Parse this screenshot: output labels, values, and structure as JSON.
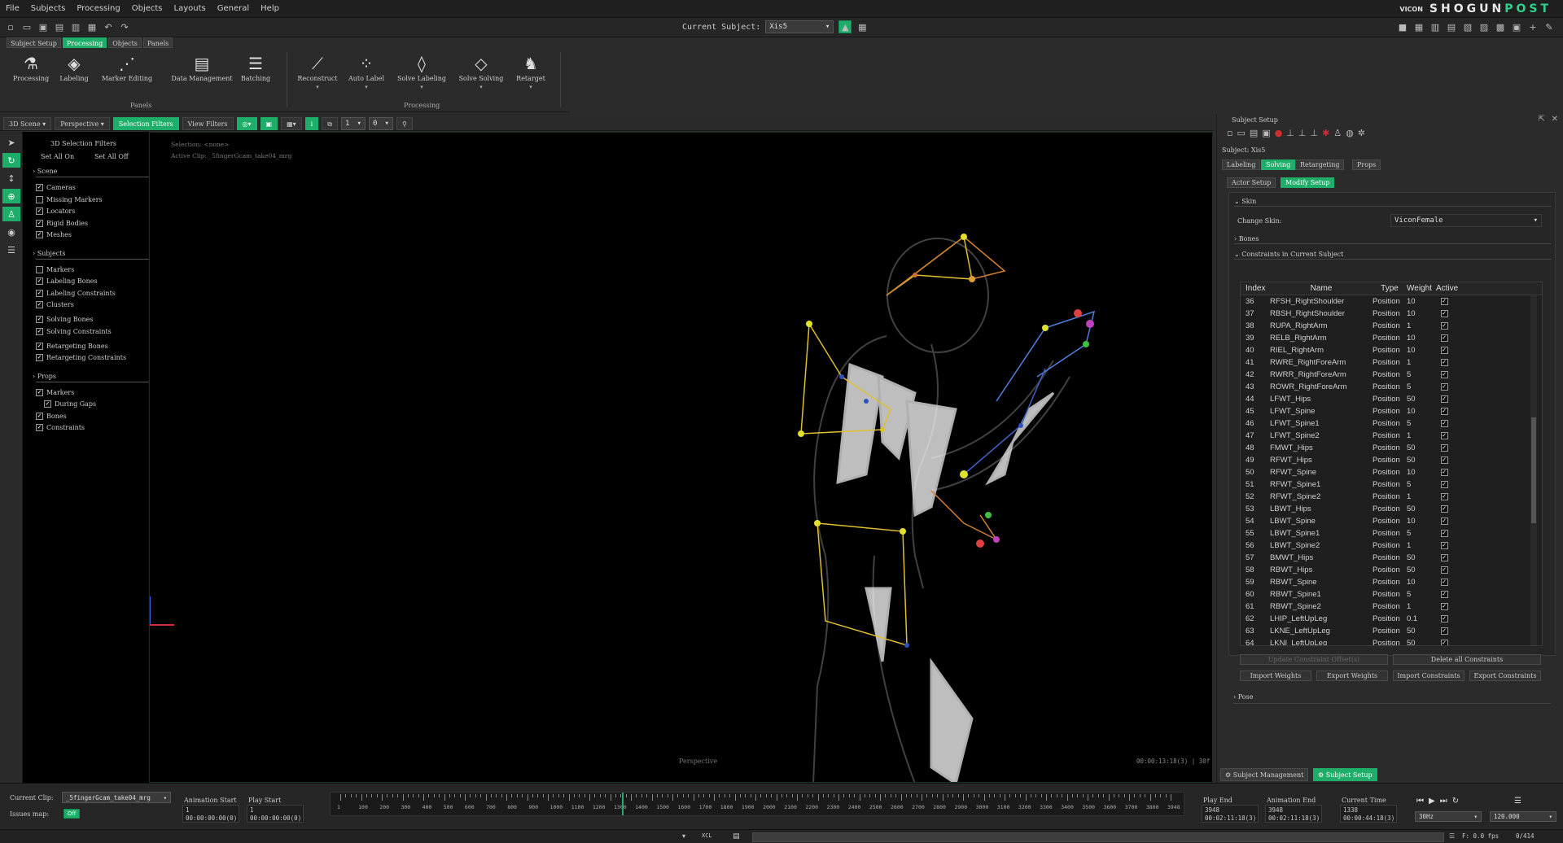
{
  "menu": [
    "File",
    "Subjects",
    "Processing",
    "Objects",
    "Layouts",
    "General",
    "Help"
  ],
  "brand": {
    "vicon": "VICON",
    "shogun": "SHOGUN",
    "post": "POST"
  },
  "current_subject": {
    "label": "Current Subject:",
    "value": "Xis5"
  },
  "mode_tabs": [
    "Subject Setup",
    "Processing",
    "Objects",
    "Panels"
  ],
  "ribbon": {
    "buttons": [
      "Processing",
      "Labeling",
      "Marker Editing",
      "Data Management",
      "Batching",
      "Reconstruct",
      "Auto Label",
      "Solve Labeling",
      "Solve Solving",
      "Retarget"
    ],
    "groups": [
      "Panels",
      "Processing"
    ]
  },
  "viewport_bar": {
    "scene": "3D Scene",
    "view": "Perspective",
    "selection_filters": "Selection Filters",
    "view_filters": "View Filters",
    "field1": "1",
    "field2": "0"
  },
  "filters": {
    "title": "3D Selection Filters",
    "set_all_on": "Set All On",
    "set_all_off": "Set All Off",
    "sections": [
      {
        "name": "Scene",
        "items": [
          {
            "label": "Cameras",
            "checked": true
          },
          {
            "label": "Missing Markers",
            "checked": false
          },
          {
            "label": "Locators",
            "checked": true
          },
          {
            "label": "Rigid Bodies",
            "checked": true
          },
          {
            "label": "Meshes",
            "checked": true
          }
        ]
      },
      {
        "name": "Subjects",
        "items": [
          {
            "label": "Markers",
            "checked": false
          },
          {
            "label": "Labeling Bones",
            "checked": true
          },
          {
            "label": "Labeling Constraints",
            "checked": true
          },
          {
            "label": "Clusters",
            "checked": true
          },
          {
            "label": "Solving Bones",
            "checked": true
          },
          {
            "label": "Solving Constraints",
            "checked": true
          },
          {
            "label": "Retargeting Bones",
            "checked": true
          },
          {
            "label": "Retargeting Constraints",
            "checked": true
          }
        ]
      },
      {
        "name": "Props",
        "items": [
          {
            "label": "Markers",
            "checked": true
          },
          {
            "label": "During Gaps",
            "checked": true
          },
          {
            "label": "Bones",
            "checked": true
          },
          {
            "label": "Constraints",
            "checked": true
          }
        ]
      }
    ]
  },
  "viewport": {
    "selection": "Selection: <none>",
    "active_clip": "Active Clip: _5fingerGcam_take04_mrg",
    "camera_label": "Perspective",
    "timecode": "00:00:13:18(3) | 30f"
  },
  "subject_setup": {
    "panel_title": "Subject Setup",
    "subject": "Subject: Xis5",
    "tabs": [
      "Labeling",
      "Solving",
      "Retargeting",
      "Props"
    ],
    "subtabs": [
      "Actor Setup",
      "Modify Setup"
    ],
    "skin_section": "Skin",
    "change_skin_label": "Change Skin:",
    "change_skin_value": "ViconFemale",
    "bones_section": "Bones",
    "constraints_section": "Constraints in Current Subject",
    "columns": [
      "Index",
      "Name",
      "Type",
      "Weight",
      "Active"
    ],
    "rows": [
      [
        "36",
        "RFSH_RightShoulder",
        "Position",
        "10"
      ],
      [
        "37",
        "RBSH_RightShoulder",
        "Position",
        "10"
      ],
      [
        "38",
        "RUPA_RightArm",
        "Position",
        "1"
      ],
      [
        "39",
        "RELB_RightArm",
        "Position",
        "10"
      ],
      [
        "40",
        "RIEL_RightArm",
        "Position",
        "10"
      ],
      [
        "41",
        "RWRE_RightForeArm",
        "Position",
        "1"
      ],
      [
        "42",
        "RWRR_RightForeArm",
        "Position",
        "5"
      ],
      [
        "43",
        "ROWR_RightForeArm",
        "Position",
        "5"
      ],
      [
        "44",
        "LFWT_Hips",
        "Position",
        "50"
      ],
      [
        "45",
        "LFWT_Spine",
        "Position",
        "10"
      ],
      [
        "46",
        "LFWT_Spine1",
        "Position",
        "5"
      ],
      [
        "47",
        "LFWT_Spine2",
        "Position",
        "1"
      ],
      [
        "48",
        "FMWT_Hips",
        "Position",
        "50"
      ],
      [
        "49",
        "RFWT_Hips",
        "Position",
        "50"
      ],
      [
        "50",
        "RFWT_Spine",
        "Position",
        "10"
      ],
      [
        "51",
        "RFWT_Spine1",
        "Position",
        "5"
      ],
      [
        "52",
        "RFWT_Spine2",
        "Position",
        "1"
      ],
      [
        "53",
        "LBWT_Hips",
        "Position",
        "50"
      ],
      [
        "54",
        "LBWT_Spine",
        "Position",
        "10"
      ],
      [
        "55",
        "LBWT_Spine1",
        "Position",
        "5"
      ],
      [
        "56",
        "LBWT_Spine2",
        "Position",
        "1"
      ],
      [
        "57",
        "BMWT_Hips",
        "Position",
        "50"
      ],
      [
        "58",
        "RBWT_Hips",
        "Position",
        "50"
      ],
      [
        "59",
        "RBWT_Spine",
        "Position",
        "10"
      ],
      [
        "60",
        "RBWT_Spine1",
        "Position",
        "5"
      ],
      [
        "61",
        "RBWT_Spine2",
        "Position",
        "1"
      ],
      [
        "62",
        "LHIP_LeftUpLeg",
        "Position",
        "0.1"
      ],
      [
        "63",
        "LKNE_LeftUpLeg",
        "Position",
        "50"
      ],
      [
        "64",
        "LKNI_LeftUpLeg",
        "Position",
        "50"
      ]
    ],
    "update_offset": "Update Constraint Offset(s)",
    "delete_all": "Delete all Constraints",
    "import_weights": "Import Weights",
    "export_weights": "Export Weights",
    "import_constraints": "Import Constraints",
    "export_constraints": "Export Constraints",
    "pose_section": "Pose",
    "bottom_tabs": [
      "Subject Management",
      "Subject Setup"
    ]
  },
  "bottom": {
    "current_clip_label": "Current Clip:",
    "current_clip": "_5fingerGcam_take04_mrg",
    "issues_label": "Issues map:",
    "issues_toggle": "Off",
    "animation_start_label": "Animation Start",
    "animation_start": "1",
    "animation_start_tc": "00:00:00:00(0)",
    "play_start_label": "Play Start",
    "play_start": "1",
    "play_start_tc": "00:00:00:00(0)",
    "play_end_label": "Play End",
    "play_end": "3948",
    "play_end_tc": "00:02:11:18(3)",
    "animation_end_label": "Animation End",
    "animation_end": "3948",
    "animation_end_tc": "00:02:11:18(3)",
    "current_time_label": "Current Time",
    "current_time": "1338",
    "current_time_tc": "00:00:44:18(3)",
    "fps_combo": "30Hz",
    "speed": "120.000",
    "fps_readout": "F: 0.0 fps",
    "frame_readout": "0/414",
    "timeline_ticks": [
      "1",
      "100",
      "200",
      "300",
      "400",
      "500",
      "600",
      "700",
      "800",
      "900",
      "1000",
      "1100",
      "1200",
      "1300",
      "1400",
      "1500",
      "1600",
      "1700",
      "1800",
      "1900",
      "2000",
      "2100",
      "2200",
      "2300",
      "2400",
      "2500",
      "2600",
      "2700",
      "2800",
      "2900",
      "3000",
      "3100",
      "3200",
      "3300",
      "3400",
      "3500",
      "3600",
      "3700",
      "3800",
      "3948"
    ],
    "xcl": "XCL"
  }
}
